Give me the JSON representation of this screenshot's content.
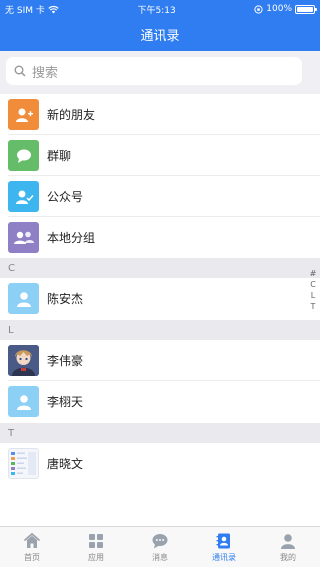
{
  "status_bar": {
    "carrier": "无 SIM 卡",
    "time": "下午5:13",
    "battery": "100%"
  },
  "nav": {
    "title": "通讯录"
  },
  "search": {
    "placeholder": "搜索"
  },
  "top_items": [
    {
      "label": "新的朋友",
      "icon": "add-friend-icon",
      "color": "#f08c3a"
    },
    {
      "label": "群聊",
      "icon": "group-chat-icon",
      "color": "#65bd6a"
    },
    {
      "label": "公众号",
      "icon": "official-account-icon",
      "color": "#3db5ee"
    },
    {
      "label": "本地分组",
      "icon": "local-group-icon",
      "color": "#8f7fc5"
    }
  ],
  "sections": [
    {
      "letter": "C",
      "contacts": [
        {
          "name": "陈安杰",
          "avatar": "default-avatar-icon"
        }
      ]
    },
    {
      "letter": "L",
      "contacts": [
        {
          "name": "李伟豪",
          "avatar": "anime-avatar"
        },
        {
          "name": "李栩天",
          "avatar": "default-avatar-icon"
        }
      ]
    },
    {
      "letter": "T",
      "contacts": [
        {
          "name": "唐晓文",
          "avatar": "app-screenshot-avatar"
        }
      ]
    }
  ],
  "index_bar": [
    "#",
    "C",
    "L",
    "T"
  ],
  "tabs": [
    {
      "label": "首页",
      "icon": "home-icon",
      "active": false
    },
    {
      "label": "应用",
      "icon": "apps-icon",
      "active": false
    },
    {
      "label": "消息",
      "icon": "message-icon",
      "active": false
    },
    {
      "label": "通讯录",
      "icon": "contacts-icon",
      "active": true
    },
    {
      "label": "我的",
      "icon": "profile-icon",
      "active": false
    }
  ],
  "colors": {
    "accent": "#2f7df0",
    "default_avatar": "#8dd0f5"
  }
}
